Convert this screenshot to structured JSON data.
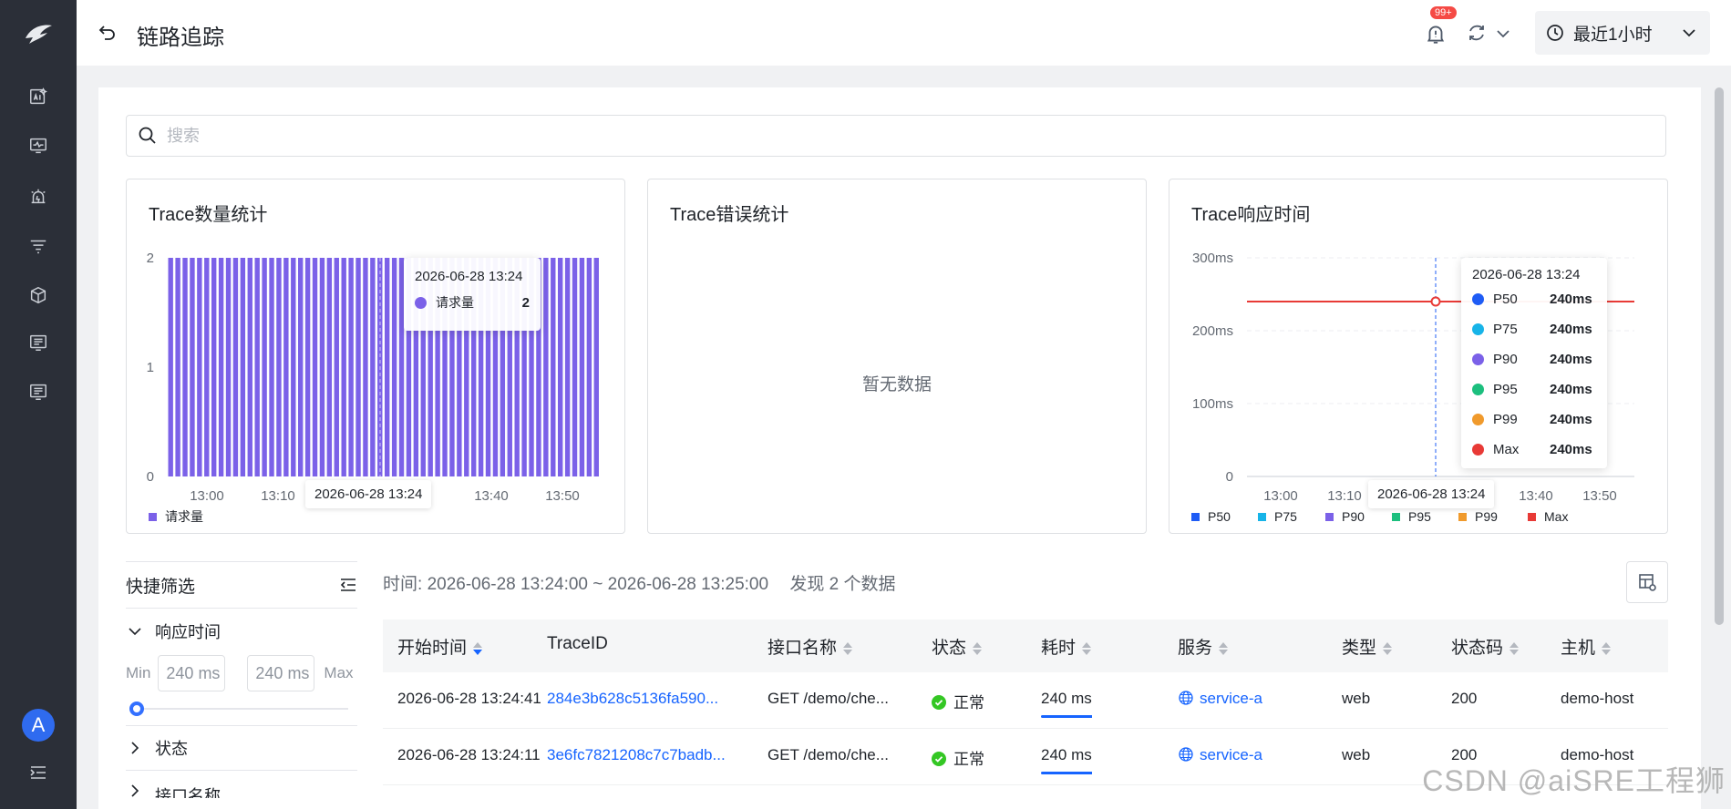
{
  "header": {
    "title": "链路追踪",
    "badge": "99+",
    "time_range": "最近1小时"
  },
  "search": {
    "placeholder": "搜索"
  },
  "cards": {
    "count": {
      "title": "Trace数量统计",
      "legend": "请求量"
    },
    "error": {
      "title": "Trace错误统计",
      "empty": "暂无数据"
    },
    "latency": {
      "title": "Trace响应时间"
    }
  },
  "chart_data": [
    {
      "type": "bar",
      "title": "Trace数量统计",
      "x_ticks": [
        "13:00",
        "13:10",
        "13:40",
        "13:50"
      ],
      "y_ticks": [
        "0",
        "1",
        "2"
      ],
      "ylim": [
        0,
        2
      ],
      "series": [
        {
          "name": "请求量",
          "color": "#7b61e8",
          "value_per_bar": 2,
          "bar_count": 60
        }
      ],
      "hover": {
        "time": "2026-06-28 13:24",
        "label": "请求量",
        "value": "2",
        "axis_label": "2026-06-28 13:24"
      }
    },
    {
      "type": "line",
      "title": "Trace响应时间",
      "x_ticks": [
        "13:00",
        "13:10",
        "13:40",
        "13:50"
      ],
      "y_ticks": [
        "0",
        "100ms",
        "200ms",
        "300ms"
      ],
      "ylim": [
        0,
        300
      ],
      "series": [
        {
          "name": "P50",
          "color": "#1f5cf5",
          "value": 240
        },
        {
          "name": "P75",
          "color": "#17b4e8",
          "value": 240
        },
        {
          "name": "P90",
          "color": "#7b61e8",
          "value": 240
        },
        {
          "name": "P95",
          "color": "#1cbf7e",
          "value": 240
        },
        {
          "name": "P99",
          "color": "#f09a2c",
          "value": 240
        },
        {
          "name": "Max",
          "color": "#e83a36",
          "value": 240
        }
      ],
      "hover": {
        "time": "2026-06-28 13:24",
        "axis_label": "2026-06-28 13:24",
        "rows": [
          {
            "name": "P50",
            "value": "240ms"
          },
          {
            "name": "P75",
            "value": "240ms"
          },
          {
            "name": "P90",
            "value": "240ms"
          },
          {
            "name": "P95",
            "value": "240ms"
          },
          {
            "name": "P99",
            "value": "240ms"
          },
          {
            "name": "Max",
            "value": "240ms"
          }
        ]
      }
    }
  ],
  "filter": {
    "title": "快捷筛选",
    "response_time": "响应时间",
    "min_label": "Min",
    "max_label": "Max",
    "min_value": "240 ms",
    "max_value": "240 ms",
    "status": "状态",
    "next_partial": "接口名称"
  },
  "summary": {
    "time_label": "时间:",
    "time_value": "2026-06-28 13:24:00 ~ 2026-06-28 13:25:00",
    "found": "发现 2 个数据"
  },
  "table": {
    "columns": [
      "开始时间",
      "TraceID",
      "接口名称",
      "状态",
      "耗时",
      "服务",
      "类型",
      "状态码",
      "主机"
    ],
    "rows": [
      {
        "start": "2026-06-28 13:24:41",
        "trace_id": "284e3b628c5136fa590...",
        "api": "GET /demo/che...",
        "status": "正常",
        "duration": "240 ms",
        "service": "service-a",
        "type": "web",
        "code": "200",
        "host": "demo-host"
      },
      {
        "start": "2026-06-28 13:24:11",
        "trace_id": "3e6fc7821208c7c7badb...",
        "api": "GET /demo/che...",
        "status": "正常",
        "duration": "240 ms",
        "service": "service-a",
        "type": "web",
        "code": "200",
        "host": "demo-host"
      }
    ]
  },
  "watermark": "CSDN @aiSRE工程狮"
}
